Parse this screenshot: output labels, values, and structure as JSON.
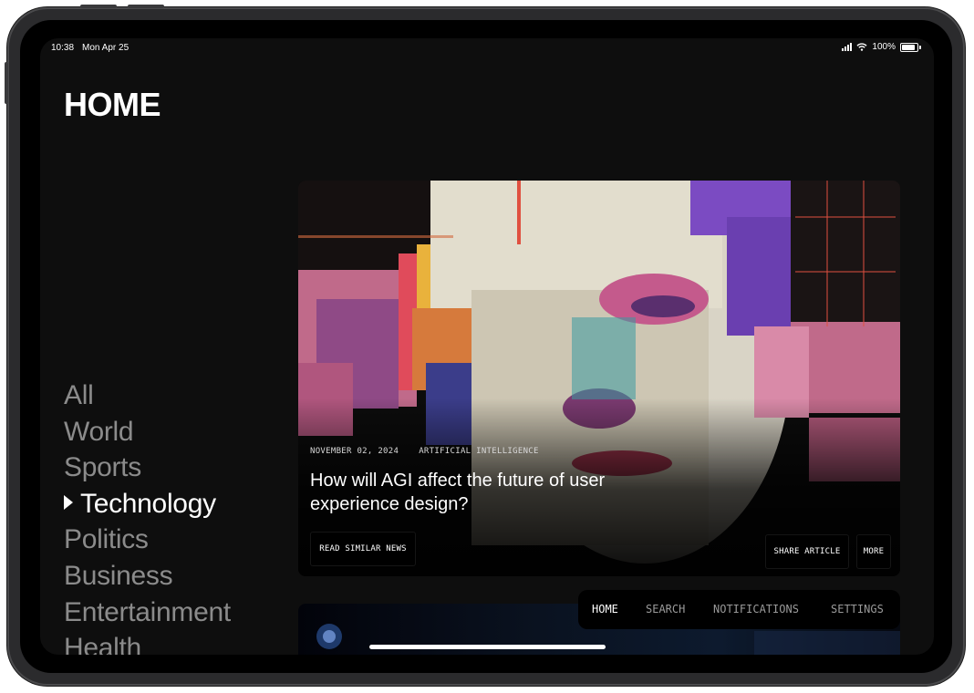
{
  "status": {
    "time": "10:38",
    "date": "Mon Apr 25",
    "battery": "100%"
  },
  "page": {
    "title": "HOME"
  },
  "categories": [
    {
      "label": "All",
      "active": false
    },
    {
      "label": "World",
      "active": false
    },
    {
      "label": "Sports",
      "active": false
    },
    {
      "label": "Technology",
      "active": true
    },
    {
      "label": "Politics",
      "active": false
    },
    {
      "label": "Business",
      "active": false
    },
    {
      "label": "Entertainment",
      "active": false
    },
    {
      "label": "Health",
      "active": false
    }
  ],
  "featured": {
    "date": "NOVEMBER 02, 2024",
    "tag": "ARTIFICIAL INTELLIGENCE",
    "headline": "How will AGI affect the future of user experience design?",
    "read_similar_label": "READ SIMILAR NEWS",
    "share_label": "SHARE ARTICLE",
    "more_label": "MORE"
  },
  "nav": {
    "items": [
      {
        "label": "HOME",
        "active": true
      },
      {
        "label": "SEARCH",
        "active": false
      },
      {
        "label": "NOTIFICATIONS",
        "active": false
      },
      {
        "label": "SETTINGS",
        "active": false
      }
    ]
  },
  "colors": {
    "background": "#0e0e0e",
    "inactive_text": "#8b8b8b",
    "active_text": "#ffffff"
  }
}
